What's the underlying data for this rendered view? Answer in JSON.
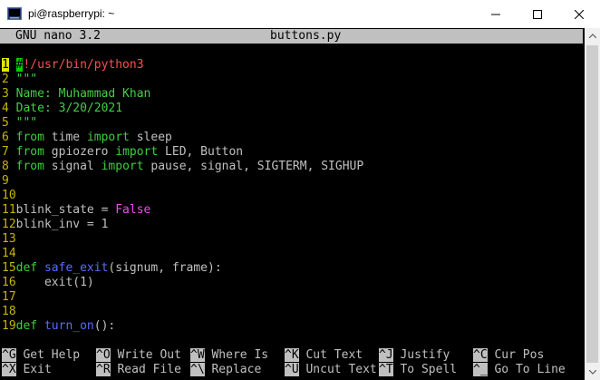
{
  "window": {
    "title": "pi@raspberrypi: ~",
    "icon": "putty-terminal-icon"
  },
  "nano": {
    "version": "GNU nano 3.2",
    "filename": "buttons.py"
  },
  "colors": {
    "background": "#000000",
    "text": "#c0c0c0",
    "line_number": "#c8b400",
    "keyword": "#3cd13c",
    "string": "#43d043",
    "function_name": "#5a6bff",
    "boolean": "#e94fe9",
    "shebang": "#ff4d4d",
    "cursor": "#00d000",
    "header_bg": "#c0c0c0"
  },
  "lines": [
    {
      "num": "1",
      "parts": [
        {
          "t": "#",
          "c": "cursor"
        },
        {
          "t": "!/usr/bin/python3",
          "c": "red"
        }
      ]
    },
    {
      "num": "2",
      "parts": [
        {
          "t": "\"\"\"",
          "c": "green"
        }
      ]
    },
    {
      "num": "3",
      "parts": [
        {
          "t": "Name: Muhammad Khan",
          "c": "green"
        }
      ]
    },
    {
      "num": "4",
      "parts": [
        {
          "t": "Date: 3/20/2021",
          "c": "green"
        }
      ]
    },
    {
      "num": "5",
      "parts": [
        {
          "t": "\"\"\"",
          "c": "green"
        }
      ]
    },
    {
      "num": "6",
      "parts": [
        {
          "t": "from",
          "c": "kw"
        },
        {
          "t": " time ",
          "c": "default"
        },
        {
          "t": "import",
          "c": "kw"
        },
        {
          "t": " sleep",
          "c": "default"
        }
      ]
    },
    {
      "num": "7",
      "parts": [
        {
          "t": "from",
          "c": "kw"
        },
        {
          "t": " gpiozero ",
          "c": "default"
        },
        {
          "t": "import",
          "c": "kw"
        },
        {
          "t": " LED, Button",
          "c": "default"
        }
      ]
    },
    {
      "num": "8",
      "parts": [
        {
          "t": "from",
          "c": "kw"
        },
        {
          "t": " signal ",
          "c": "default"
        },
        {
          "t": "import",
          "c": "kw"
        },
        {
          "t": " pause, signal, SIGTERM, SIGHUP",
          "c": "default"
        }
      ]
    },
    {
      "num": "9",
      "parts": []
    },
    {
      "num": "10",
      "parts": []
    },
    {
      "num": "11",
      "parts": [
        {
          "t": "blink_state = ",
          "c": "default"
        },
        {
          "t": "False",
          "c": "magenta"
        }
      ]
    },
    {
      "num": "12",
      "parts": [
        {
          "t": "blink_inv = 1",
          "c": "default"
        }
      ]
    },
    {
      "num": "13",
      "parts": []
    },
    {
      "num": "14",
      "parts": []
    },
    {
      "num": "15",
      "parts": [
        {
          "t": "def",
          "c": "kw"
        },
        {
          "t": " ",
          "c": "default"
        },
        {
          "t": "safe_exit",
          "c": "fn"
        },
        {
          "t": "(signum, frame):",
          "c": "default"
        }
      ]
    },
    {
      "num": "16",
      "parts": [
        {
          "t": "    exit(1)",
          "c": "default"
        }
      ]
    },
    {
      "num": "17",
      "parts": []
    },
    {
      "num": "18",
      "parts": []
    },
    {
      "num": "19",
      "parts": [
        {
          "t": "def",
          "c": "kw"
        },
        {
          "t": " ",
          "c": "default"
        },
        {
          "t": "turn_on",
          "c": "fn"
        },
        {
          "t": "():",
          "c": "default"
        }
      ]
    }
  ],
  "shortcuts": [
    [
      {
        "key": "^G",
        "label": " Get Help  "
      },
      {
        "key": "^O",
        "label": " Write Out "
      },
      {
        "key": "^W",
        "label": " Where Is  "
      },
      {
        "key": "^K",
        "label": " Cut Text  "
      },
      {
        "key": "^J",
        "label": " Justify   "
      },
      {
        "key": "^C",
        "label": " Cur Pos"
      }
    ],
    [
      {
        "key": "^X",
        "label": " Exit      "
      },
      {
        "key": "^R",
        "label": " Read File "
      },
      {
        "key": "^\\",
        "label": " Replace   "
      },
      {
        "key": "^U",
        "label": " Uncut Text"
      },
      {
        "key": "^T",
        "label": " To Spell  "
      },
      {
        "key": "^_",
        "label": " Go To Line"
      }
    ]
  ]
}
